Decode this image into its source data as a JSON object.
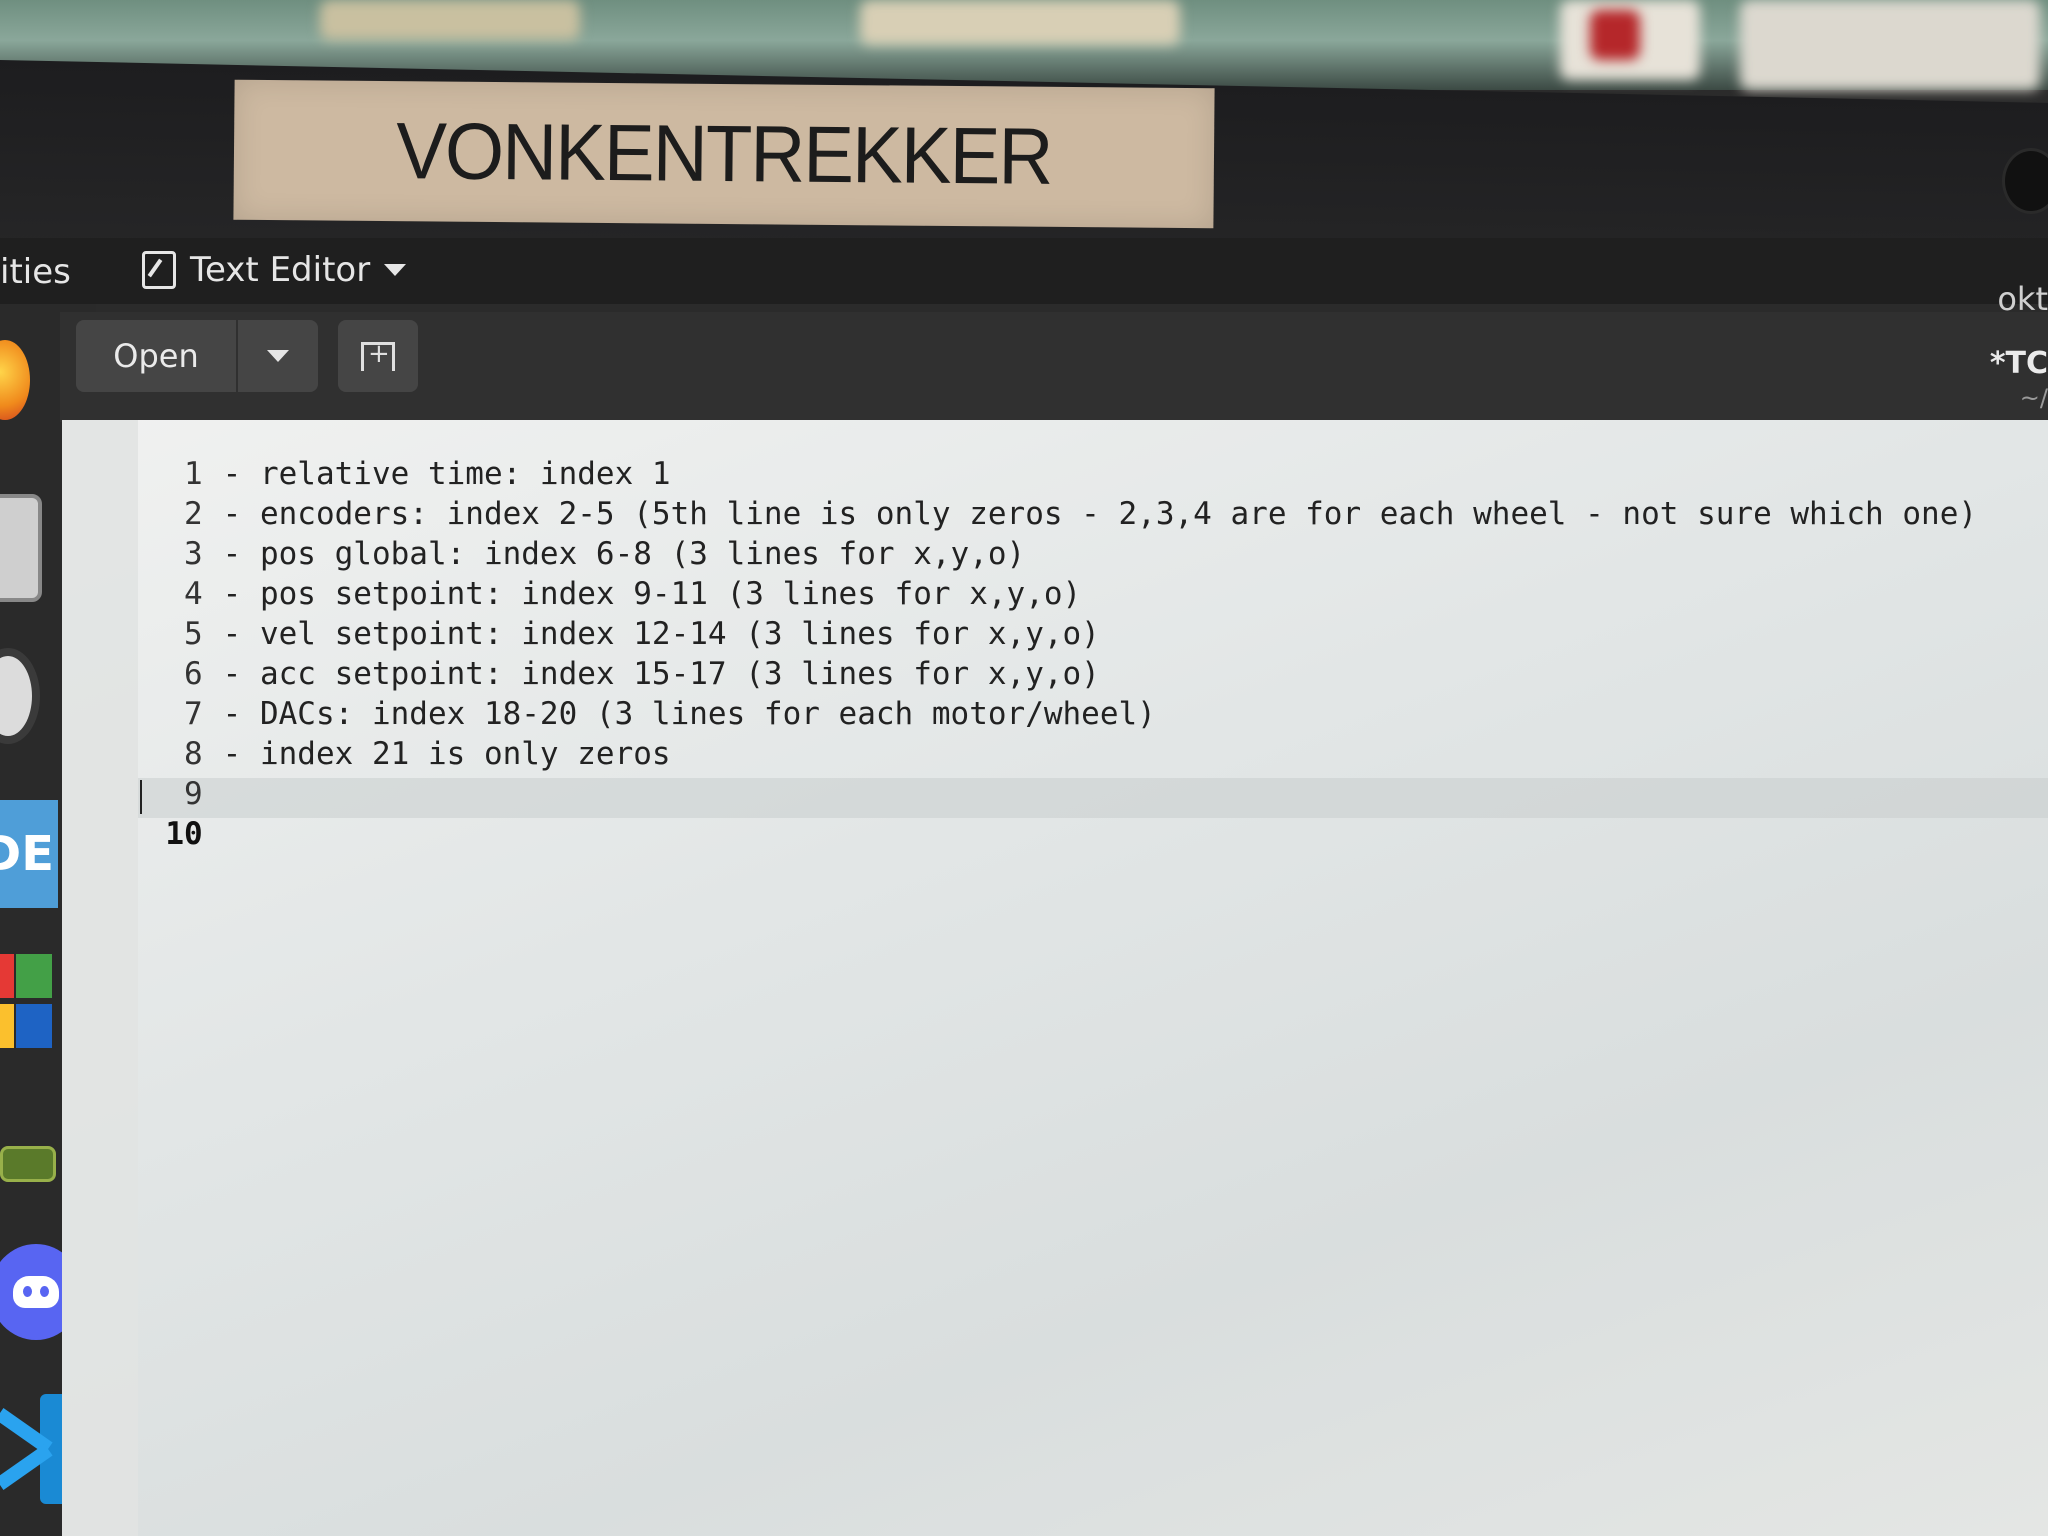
{
  "sticker": {
    "text": "VONKENTREKKER"
  },
  "topbar": {
    "activities_label": "ities",
    "app_menu_label": "Text Editor",
    "clock_fragment": "okt"
  },
  "headerbar": {
    "open_label": "Open",
    "doc_title": "*TC",
    "doc_path": "~/"
  },
  "dock": {
    "items": [
      "firefox-icon",
      "files-icon",
      "settings-icon",
      "ide-icon",
      "app-grid-icon",
      "terminal-icon",
      "discord-icon",
      "vscode-icon"
    ],
    "ide_text": "DE"
  },
  "editor": {
    "current_line": 10,
    "lines": [
      {
        "num": "1",
        "text": "- relative time: index 1"
      },
      {
        "num": "2",
        "text": "- encoders: index 2-5 (5th line is only zeros - 2,3,4 are for each wheel - not sure which one)"
      },
      {
        "num": "3",
        "text": "- pos global: index 6-8 (3 lines for x,y,o)"
      },
      {
        "num": "4",
        "text": "- pos setpoint: index 9-11 (3 lines for x,y,o)"
      },
      {
        "num": "5",
        "text": "- vel setpoint: index 12-14 (3 lines for x,y,o)"
      },
      {
        "num": "6",
        "text": "- acc setpoint: index 15-17 (3 lines for x,y,o)"
      },
      {
        "num": "7",
        "text": "- DACs: index 18-20 (3 lines for each motor/wheel)"
      },
      {
        "num": "8",
        "text": "- index 21 is only zeros"
      },
      {
        "num": "9",
        "text": ""
      },
      {
        "num": "10",
        "text": ""
      }
    ]
  },
  "colors": {
    "editor_bg": "#e6e9e8",
    "topbar_bg": "#1f1f1f",
    "headerbar_bg": "#303030",
    "sticker_bg": "#cdb9a1"
  }
}
